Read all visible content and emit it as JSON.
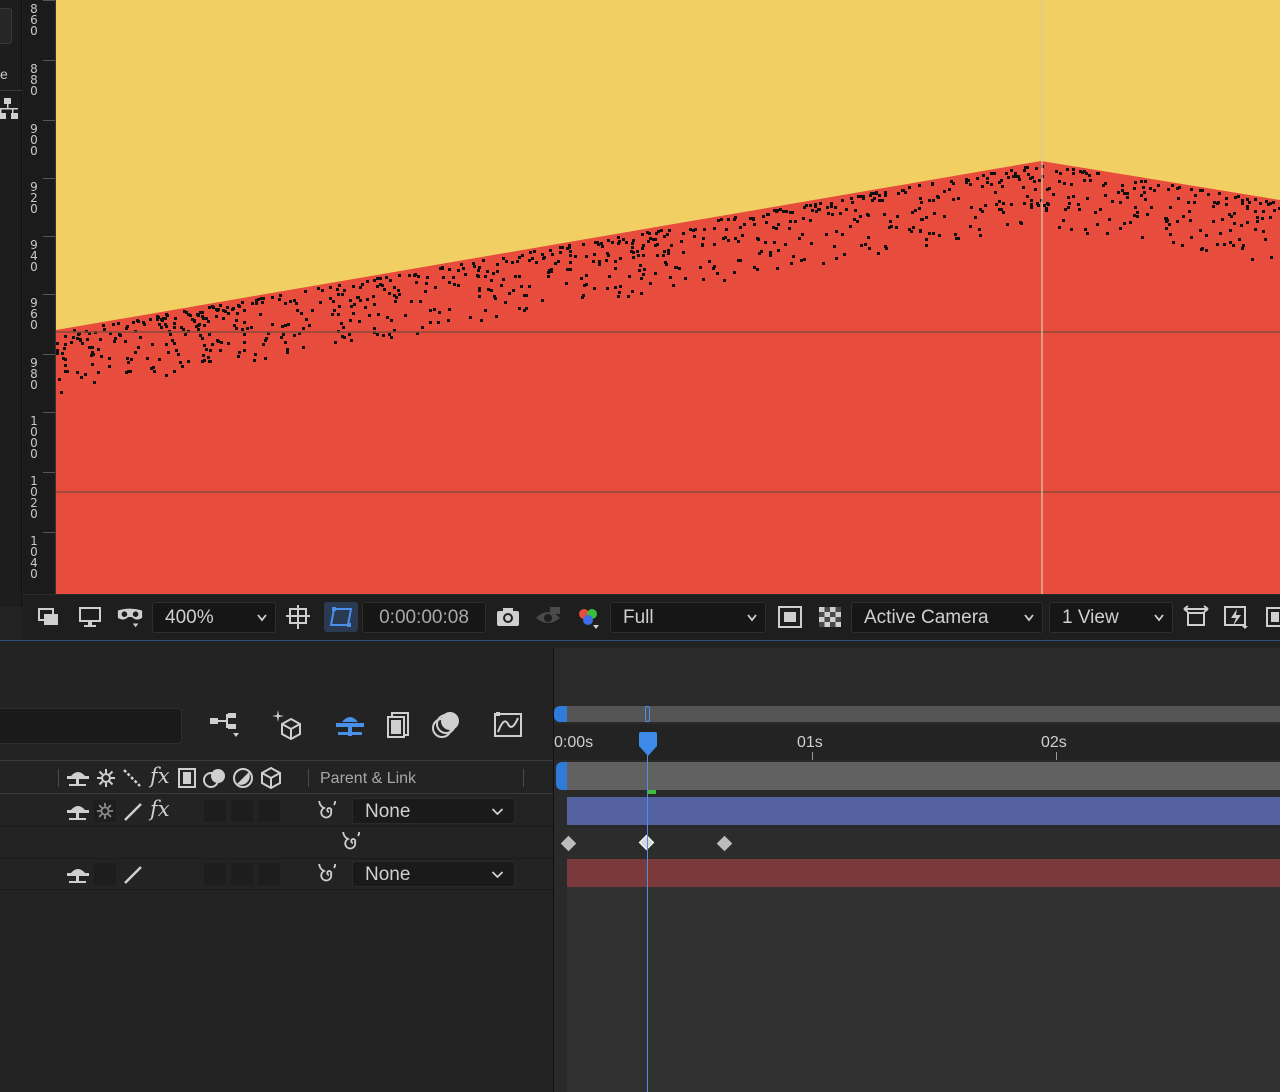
{
  "left_panel": {
    "tab_letter": "e"
  },
  "ruler": {
    "labels": [
      "860",
      "880",
      "900",
      "920",
      "940",
      "960",
      "980",
      "1000",
      "1020",
      "1040"
    ]
  },
  "viewer_toolbar": {
    "zoom": "400%",
    "timecode": "0:00:00:08",
    "resolution": "Full",
    "camera": "Active Camera",
    "views": "1 View"
  },
  "timeline": {
    "time_labels": [
      "0:00s",
      "01s",
      "02s"
    ],
    "header": {
      "parent_link": "Parent & Link"
    },
    "layers": [
      {
        "parent": "None",
        "bar_color": "#5462a2"
      },
      {
        "parent": "None",
        "bar_color": "#7a3a3c"
      }
    ]
  },
  "colors": {
    "sky": "#f2cf62",
    "mountain": "#e84c3d",
    "accent": "#2f7bdc"
  },
  "icons": {
    "viewer": [
      "preview-icon",
      "monitor-icon",
      "vr-glasses-icon",
      "region-of-interest-icon",
      "transparency-grid-icon",
      "snapshot-camera-icon",
      "show-snapshot-icon",
      "rgb-channels-icon",
      "fast-preview-icon",
      "checkerboard-icon",
      "fit-view-icon",
      "flowchart-icon"
    ],
    "timeline": [
      "composition-flowchart-icon",
      "draft-3d-icon",
      "hide-shy-layers-icon",
      "frame-blending-icon",
      "motion-blur-icon",
      "graph-editor-icon"
    ]
  }
}
